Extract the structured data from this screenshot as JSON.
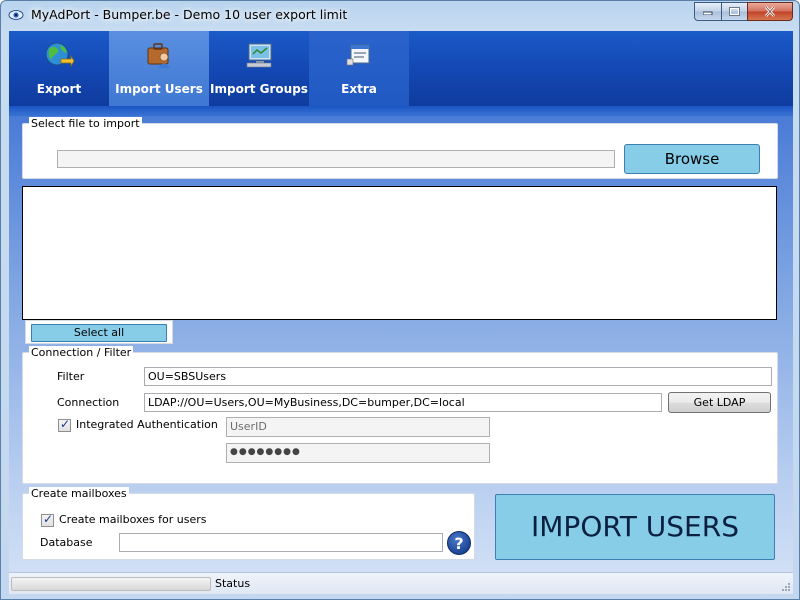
{
  "window": {
    "title": "MyAdPort - Bumper.be - Demo 10 user export limit"
  },
  "ribbon": {
    "tabs": [
      {
        "label": "Export",
        "icon": "globe-export-icon",
        "active": false
      },
      {
        "label": "Import Users",
        "icon": "briefcase-user-icon",
        "active": true
      },
      {
        "label": "Import Groups",
        "icon": "monitor-group-icon",
        "active": false
      },
      {
        "label": "Extra",
        "icon": "document-window-icon",
        "active": false
      }
    ]
  },
  "select_file": {
    "legend": "Select file to import",
    "path_value": "",
    "browse_label": "Browse"
  },
  "user_list": {
    "items": [],
    "select_all_label": "Select all"
  },
  "connection": {
    "legend": "Connection / Filter",
    "filter_label": "Filter",
    "filter_value": "OU=SBSUsers",
    "connection_label": "Connection",
    "connection_value": "LDAP://OU=Users,OU=MyBusiness,DC=bumper,DC=local",
    "get_ldap_label": "Get LDAP",
    "integrated_auth_label": "Integrated Authentication",
    "integrated_auth_checked": true,
    "userid_placeholder": "UserID",
    "password_mask": "●●●●●●●●"
  },
  "mailboxes": {
    "legend": "Create mailboxes",
    "create_label": "Create mailboxes for users",
    "create_checked": true,
    "database_label": "Database",
    "database_value": "",
    "help_icon": "?"
  },
  "actions": {
    "import_label": "IMPORT USERS"
  },
  "status": {
    "text": "Status",
    "progress": 0
  },
  "colors": {
    "ribbon": "#1448b4",
    "ribbon_active": "#4a82d8",
    "action_button": "#87cde8"
  }
}
